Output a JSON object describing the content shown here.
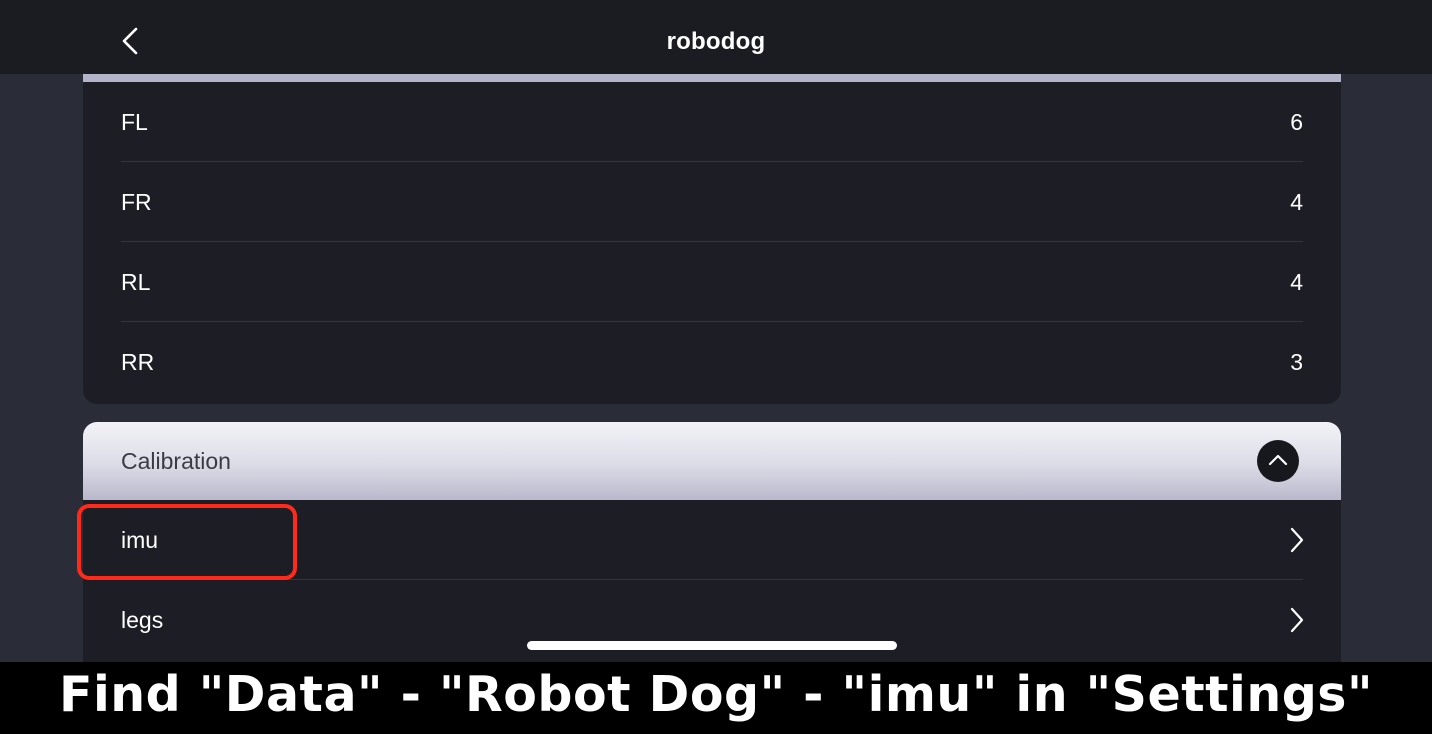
{
  "header": {
    "title": "robodog",
    "back_icon": "chevron-left-icon"
  },
  "legs_card": {
    "rows": [
      {
        "label": "FL",
        "value": "6"
      },
      {
        "label": "FR",
        "value": "4"
      },
      {
        "label": "RL",
        "value": "4"
      },
      {
        "label": "RR",
        "value": "3"
      }
    ]
  },
  "calibration": {
    "title": "Calibration",
    "toggle_icon": "chevron-up-icon",
    "items": [
      {
        "label": "imu",
        "icon": "chevron-right-icon"
      },
      {
        "label": "legs",
        "icon": "chevron-right-icon"
      }
    ]
  },
  "caption": "Find \"Data\" - \"Robot Dog\" - \"imu\" in \"Settings\"",
  "colors": {
    "highlight": "#ff2a1a",
    "background": "#2a2d38",
    "card": "#1d1e25",
    "header": "#1b1c22"
  }
}
